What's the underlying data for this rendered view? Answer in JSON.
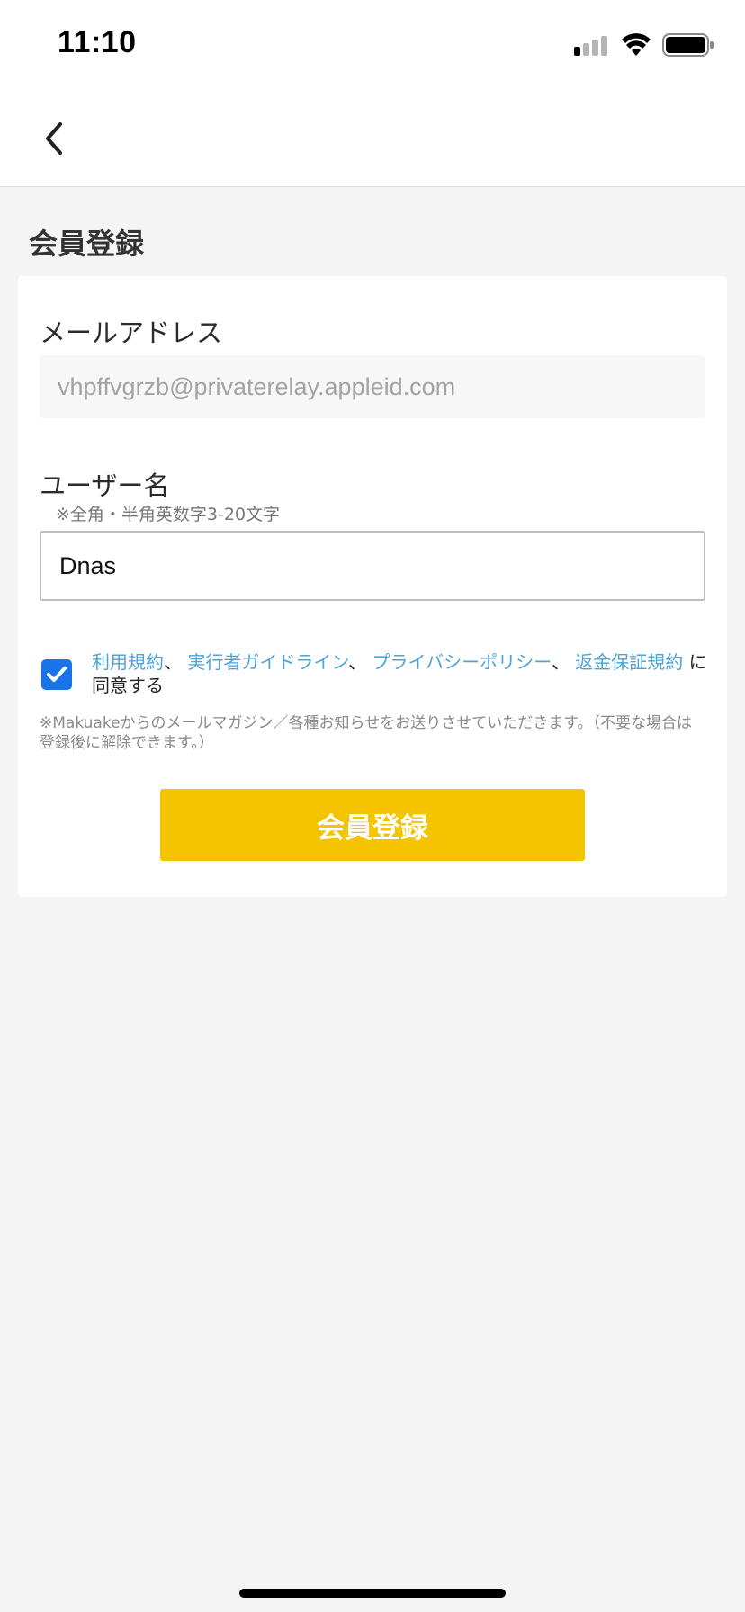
{
  "status_bar": {
    "time": "11:10",
    "icons": [
      "cellular-signal-icon",
      "wifi-icon",
      "battery-icon"
    ]
  },
  "nav": {
    "back_icon": "chevron-left-icon"
  },
  "page": {
    "title": "会員登録"
  },
  "form": {
    "email_label": "メールアドレス",
    "email_value": "vhpffvgrzb@privaterelay.appleid.com",
    "username_label": "ユーザー名",
    "username_hint": "※全角・半角英数字3-20文字",
    "username_value": "Dnas",
    "agreement": {
      "checked": true,
      "link_terms": "利用規約",
      "link_guidelines": "実行者ガイドライン",
      "link_privacy": "プライバシーポリシー",
      "link_refund": "返金保証規約",
      "separator": "、",
      "suffix": "に同意する"
    },
    "notice": "※Makuakeからのメールマガジン／各種お知らせをお送りさせていただきます。（不要な場合は登録後に解除できます。）",
    "submit_label": "会員登録"
  },
  "colors": {
    "accent_button": "#f5c400",
    "link": "#4ea3d4",
    "checkbox": "#1a73e8",
    "background": "#f4f4f4"
  }
}
